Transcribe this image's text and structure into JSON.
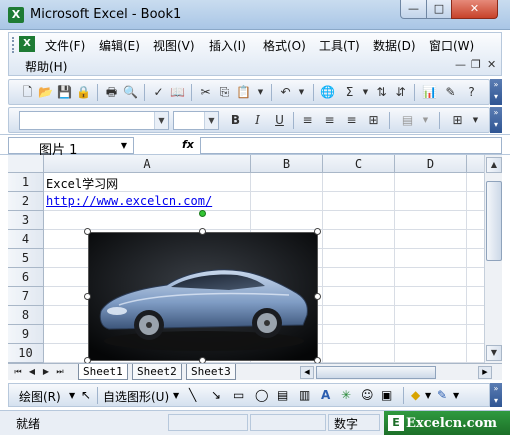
{
  "window": {
    "title": "Microsoft Excel - Book1",
    "icon": "excel-icon"
  },
  "menubar": {
    "items": [
      "文件(F)",
      "编辑(E)",
      "视图(V)",
      "插入(I)",
      "格式(O)",
      "工具(T)",
      "数据(D)",
      "窗口(W)",
      "帮助(H)"
    ]
  },
  "format_toolbar": {
    "bold": "B",
    "italic": "I",
    "underline": "U"
  },
  "formula_bar": {
    "name_box": "图片 1",
    "fx": "fx",
    "formula": ""
  },
  "grid": {
    "columns": [
      "A",
      "B",
      "C",
      "D"
    ],
    "rows": [
      "1",
      "2",
      "3",
      "4",
      "5",
      "6",
      "7",
      "8",
      "9",
      "10"
    ],
    "cells": {
      "A1": "Excel学习网",
      "A2": "http://www.excelcn.com/"
    }
  },
  "picture": {
    "name": "图片 1",
    "subject": "sports car photo"
  },
  "sheets": {
    "tabs": [
      "Sheet1",
      "Sheet2",
      "Sheet3"
    ],
    "active": "Sheet1"
  },
  "drawing_toolbar": {
    "draw_menu": "绘图(R)",
    "autoshapes_menu": "自选图形(U)"
  },
  "status": {
    "ready": "就绪",
    "num_mode": "数字"
  },
  "watermark": {
    "text": "Excelcn.com",
    "logo": "E"
  }
}
